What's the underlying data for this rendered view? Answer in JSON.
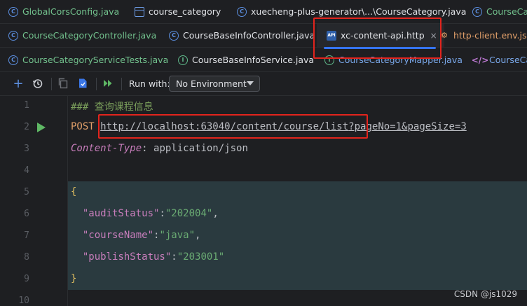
{
  "tabs_row1": [
    {
      "label": "GlobalCorsConfig.java",
      "icon": "class-icon"
    },
    {
      "label": "course_category",
      "icon": "table-icon"
    },
    {
      "label": "xuecheng-plus-generator\\...\\CourseCategory.java",
      "icon": "class-icon"
    },
    {
      "label": "CourseCa",
      "icon": "class-icon"
    }
  ],
  "tabs_row2": [
    {
      "label": "CourseCategoryController.java",
      "icon": "class-icon"
    },
    {
      "label": "CourseBaseInfoController.java",
      "icon": "class-icon"
    },
    {
      "label": "xc-content-api.http",
      "icon": "api-file-icon",
      "active": true,
      "close": "×"
    },
    {
      "label": "http-client.env.json",
      "icon": "env-json-icon"
    }
  ],
  "tabs_row3": [
    {
      "label": "CourseCategoryServiceTests.java",
      "icon": "class-icon"
    },
    {
      "label": "CourseBaseInfoService.java",
      "icon": "interface-icon"
    },
    {
      "label": "CourseCategoryMapper.java",
      "icon": "interface-icon"
    },
    {
      "label": "CourseCa",
      "icon": "html-icon"
    }
  ],
  "toolbar": {
    "run_with_label": "Run with:",
    "environment": "No Environment"
  },
  "editor": {
    "line_numbers": [
      "1",
      "2",
      "3",
      "4",
      "5",
      "6",
      "7",
      "8",
      "9",
      "10"
    ],
    "line1": "### 查询课程信息",
    "line2_method": "POST",
    "line2_url": "http://localhost:63040/content/course/list",
    "line2_query": "?pageNo=1&pageSize=3",
    "line3_header_name": "Content-Type",
    "line3_header_sep": ": ",
    "line3_header_value": "application/json",
    "line5": "{",
    "line6_key": "\"auditStatus\"",
    "line6_val": "\"202004\"",
    "line7_key": "\"courseName\"",
    "line7_val": "\"java\"",
    "line8_key": "\"publishStatus\"",
    "line8_val": "\"203001\"",
    "line9": "}"
  },
  "watermark": "CSDN @js1029",
  "colors": {
    "accent": "#3574f0",
    "highlight": "#e2241d"
  }
}
